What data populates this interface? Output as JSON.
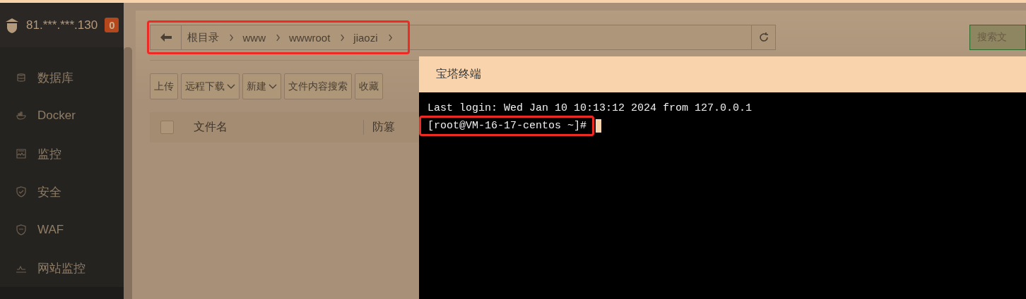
{
  "server": {
    "address": "81.***.***.130",
    "badge": "0"
  },
  "sidebar": {
    "items": [
      {
        "label": "数据库"
      },
      {
        "label": "Docker"
      },
      {
        "label": "监控"
      },
      {
        "label": "安全"
      },
      {
        "label": "WAF"
      },
      {
        "label": "网站监控"
      }
    ]
  },
  "breadcrumb": {
    "items": [
      "根目录",
      "www",
      "wwwroot",
      "jiaozi"
    ]
  },
  "search_button": "搜索文",
  "toolbar": [
    {
      "label": "上传",
      "dropdown": false
    },
    {
      "label": "远程下载",
      "dropdown": true
    },
    {
      "label": "新建",
      "dropdown": true
    },
    {
      "label": "文件内容搜索",
      "dropdown": false
    },
    {
      "label": "收藏",
      "dropdown": false
    }
  ],
  "table": {
    "columns": [
      "文件名",
      "防篡"
    ],
    "select_all_checked": false
  },
  "terminal": {
    "title": "宝塔终端",
    "lines": [
      "Last login: Wed Jan 10 10:13:12 2024 from 127.0.0.1"
    ],
    "prompt": "[root@VM-16-17-centos ~]#"
  }
}
